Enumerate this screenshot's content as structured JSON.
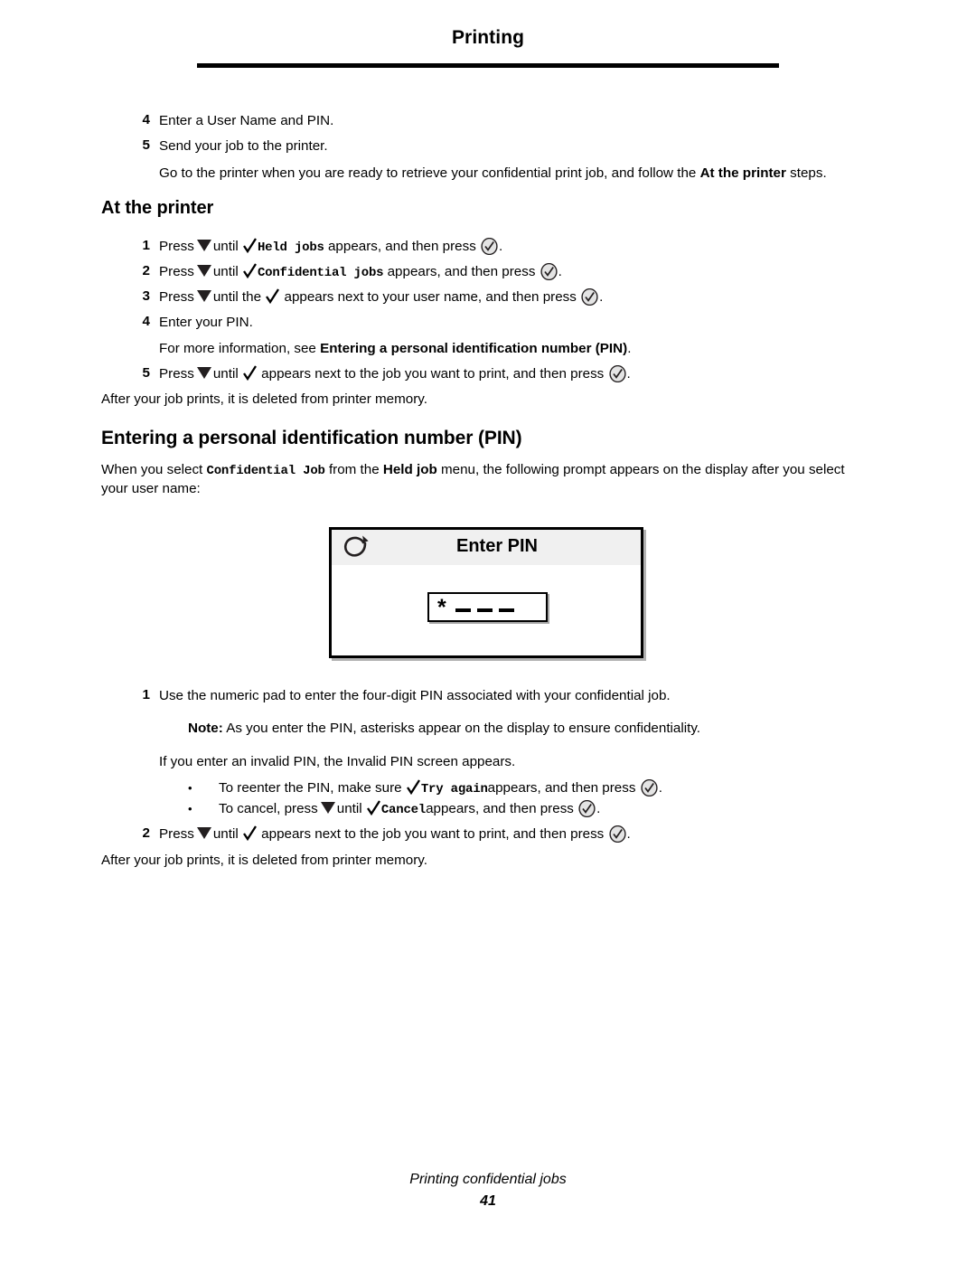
{
  "header": {
    "title": "Printing"
  },
  "intro_steps": [
    {
      "num": "4",
      "text": "Enter a User Name and PIN."
    },
    {
      "num": "5",
      "text": "Send your job to the printer."
    }
  ],
  "intro_para": {
    "before": "Go to the printer when you are ready to retrieve your confidential print job, and follow the ",
    "bold": "At the printer",
    "after": " steps."
  },
  "at_printer": {
    "heading": "At the printer",
    "step1": {
      "num": "1",
      "press": "Press",
      "until": "until",
      "menu": "Held jobs",
      "appears": "appears, and then press",
      "period": "."
    },
    "step2": {
      "num": "2",
      "press": "Press",
      "until": "until",
      "menu": "Confidential jobs",
      "appears": "appears, and then press",
      "period": "."
    },
    "step3": {
      "num": "3",
      "press": "Press",
      "until": "until the",
      "appears": "appears next to your user name, and then press",
      "period": "."
    },
    "step4": {
      "num": "4",
      "text": "Enter your PIN."
    },
    "step4_note": {
      "before": "For more information, see ",
      "bold": "Entering a personal identification number (PIN)",
      "after": "."
    },
    "step5": {
      "num": "5",
      "press": "Press",
      "until": "until",
      "appears": "appears next to the job you want to print, and then press",
      "period": "."
    },
    "after_text": "After your job prints, it is deleted from printer memory."
  },
  "pin_section": {
    "heading": "Entering a personal identification number (PIN)",
    "intro_line1_a": "When you select ",
    "intro_line1_mono": "Confidential Job",
    "intro_line1_b": " from the ",
    "intro_line1_bold": "Held job",
    "intro_line1_c": " menu, the following prompt appears on the display after you select",
    "intro_line2": "your user name:"
  },
  "display": {
    "title": "Enter PIN",
    "back_icon": "back-arrow-icon",
    "pin_value": "*",
    "pin_blanks": 3
  },
  "pin_steps": {
    "step1": {
      "num": "1",
      "text": "Use the numeric pad to enter the four-digit PIN associated with your confidential job."
    },
    "note": {
      "label": "Note:",
      "text": " As you enter the PIN, asterisks appear on the display to ensure confidentiality."
    },
    "invalid_text": "If you enter an invalid PIN, the Invalid PIN screen appears.",
    "bullet1": {
      "marker": "•",
      "before": "To reenter the PIN, make sure",
      "mono": "Try again",
      "after": "appears, and then press",
      "period": "."
    },
    "bullet2": {
      "marker": "•",
      "before": "To cancel, press",
      "until": "until",
      "mono": "Cancel",
      "after": "appears, and then press",
      "period": "."
    },
    "step2": {
      "num": "2",
      "press": "Press",
      "until": "until",
      "appears": "appears next to the job you want to print, and then press",
      "period": "."
    },
    "after_text": "After your job prints, it is deleted from printer memory."
  },
  "footer": {
    "text": "Printing confidential jobs",
    "page": "41"
  },
  "colors": {
    "text": "#000000",
    "icon_dark": "#231f20",
    "titlebar_bg": "#f0f0f0"
  }
}
